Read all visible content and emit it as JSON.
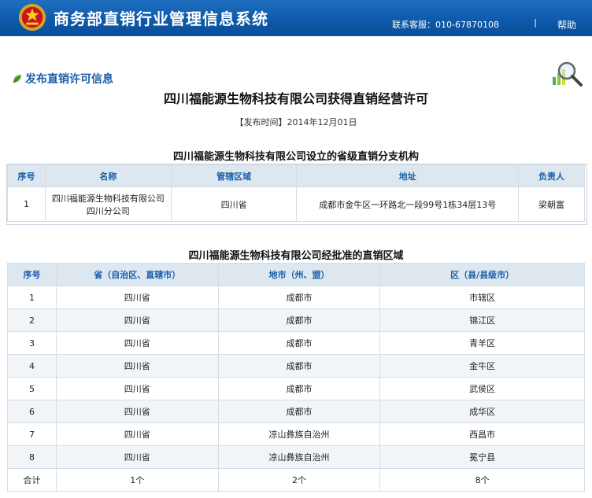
{
  "header": {
    "site_title": "商务部直销行业管理信息系统",
    "contact": "联系客服：010-67870108",
    "separator": "|",
    "help": "帮助"
  },
  "section": {
    "label": "发布直销许可信息"
  },
  "notice": {
    "title": "四川福能源生物科技有限公司获得直销经营许可",
    "publish_time": "【发布时间】2014年12月01日"
  },
  "branch_table": {
    "title": "四川福能源生物科技有限公司设立的省级直销分支机构",
    "headers": [
      "序号",
      "名称",
      "管辖区域",
      "地址",
      "负责人"
    ],
    "rows": [
      [
        "1",
        "四川福能源生物科技有限公司四川分公司",
        "四川省",
        "成都市金牛区一环路北一段99号1栋34层13号",
        "梁朝富"
      ]
    ]
  },
  "area_table": {
    "title": "四川福能源生物科技有限公司经批准的直销区域",
    "headers": [
      "序号",
      "省（自治区、直辖市）",
      "地市（州、盟）",
      "区（县/县级市）"
    ],
    "rows": [
      [
        "1",
        "四川省",
        "成都市",
        "市辖区"
      ],
      [
        "2",
        "四川省",
        "成都市",
        "锦江区"
      ],
      [
        "3",
        "四川省",
        "成都市",
        "青羊区"
      ],
      [
        "4",
        "四川省",
        "成都市",
        "金牛区"
      ],
      [
        "5",
        "四川省",
        "成都市",
        "武侯区"
      ],
      [
        "6",
        "四川省",
        "成都市",
        "成华区"
      ],
      [
        "7",
        "四川省",
        "凉山彝族自治州",
        "西昌市"
      ],
      [
        "8",
        "四川省",
        "凉山彝族自治州",
        "冕宁县"
      ]
    ],
    "total": [
      "合计",
      "1个",
      "2个",
      "8个"
    ]
  },
  "colors": {
    "header_blue": "#0d58a8",
    "link_blue": "#1a5ea8",
    "table_head_bg": "#dde7f0"
  },
  "icons": [
    "national-emblem-icon",
    "leaf-icon",
    "magnifier-chart-icon"
  ]
}
